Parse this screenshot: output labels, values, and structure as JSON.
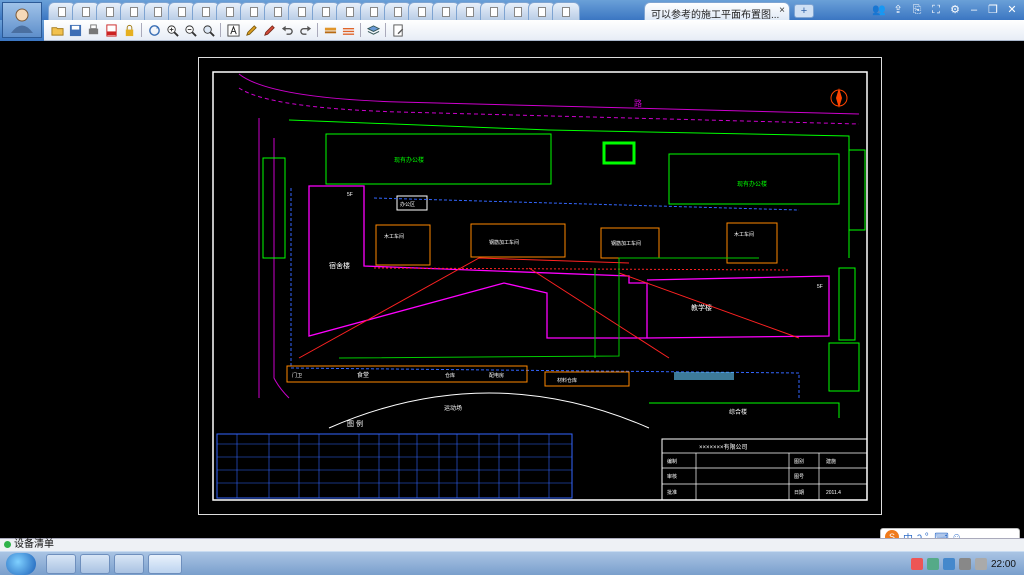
{
  "window": {
    "active_tab_title": "可以参考的施工平面布置图...",
    "tab_close": "×",
    "new_tab": "+",
    "controls": [
      "👥",
      "⇪",
      "⎘",
      "⛶",
      "⚙",
      "–",
      "❐",
      "✕"
    ]
  },
  "toolbar": {
    "buttons": [
      "open-folder",
      "save",
      "print",
      "pdf",
      "lock",
      "redraw",
      "zoom-in",
      "zoom-out",
      "zoom-window",
      "text",
      "pen",
      "highlighter",
      "undo",
      "redo",
      "layer-a",
      "layer-b",
      "layers",
      "edit"
    ]
  },
  "drawing": {
    "road_label": "路",
    "office_left": "现有办公楼",
    "office_right": "现有办公楼",
    "dorm": "宿舍楼",
    "teaching": "教学楼",
    "sports": "运动场",
    "composite": "综合楼",
    "legend_title": "图 例",
    "rooms": [
      "办公区",
      "木工车间",
      "钢筋加工车间",
      "钢筋加工车间",
      "木工车间"
    ],
    "canteen_row": [
      "门卫",
      "食堂",
      "仓库",
      "配电房"
    ],
    "store": "材料仓库",
    "fire": "消防水池",
    "floors": [
      "5F",
      "5F"
    ],
    "title_block": {
      "company": "×××××××有限公司",
      "rows": [
        [
          "编制",
          "",
          "图别",
          "建施"
        ],
        [
          "审核",
          "",
          "图号",
          ""
        ],
        [
          "批准",
          "",
          "日期",
          "2011.4"
        ]
      ]
    }
  },
  "status": {
    "label": "设备清单"
  },
  "ime": {
    "brand": "S",
    "mode": "中",
    "extras": "ↄ °, ⌨ ☺"
  },
  "tray": {
    "time": "22:00"
  }
}
